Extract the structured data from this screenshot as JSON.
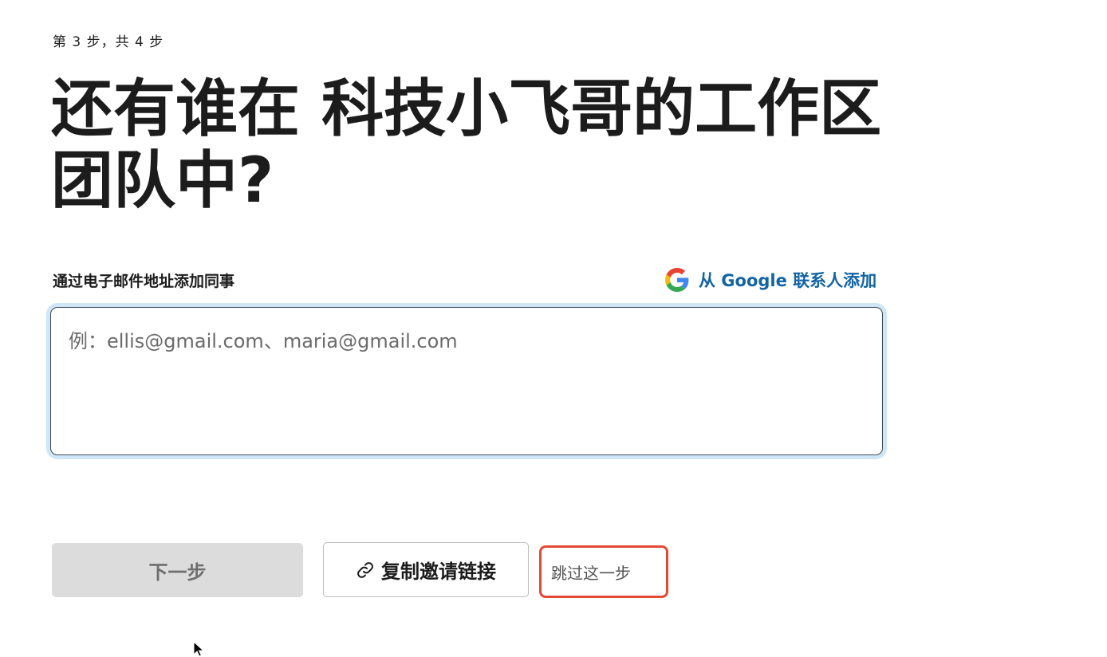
{
  "step_indicator": "第 3 步，共 4 步",
  "title": "还有谁在 科技小飞哥的工作区 团队中?",
  "email_section": {
    "label": "通过电子邮件地址添加同事",
    "google_link": "从 Google 联系人添加",
    "google_icon": "google-icon",
    "placeholder": "例：ellis@gmail.com、maria@gmail.com",
    "value": ""
  },
  "buttons": {
    "next": "下一步",
    "copy_invite_link": "复制邀请链接",
    "copy_icon": "link-icon",
    "skip": "跳过这一步"
  },
  "colors": {
    "link": "#1264a3",
    "focus_ring": "#cfe6f7",
    "highlight": "#e24a34",
    "disabled_button_bg": "#dcdcdc"
  }
}
